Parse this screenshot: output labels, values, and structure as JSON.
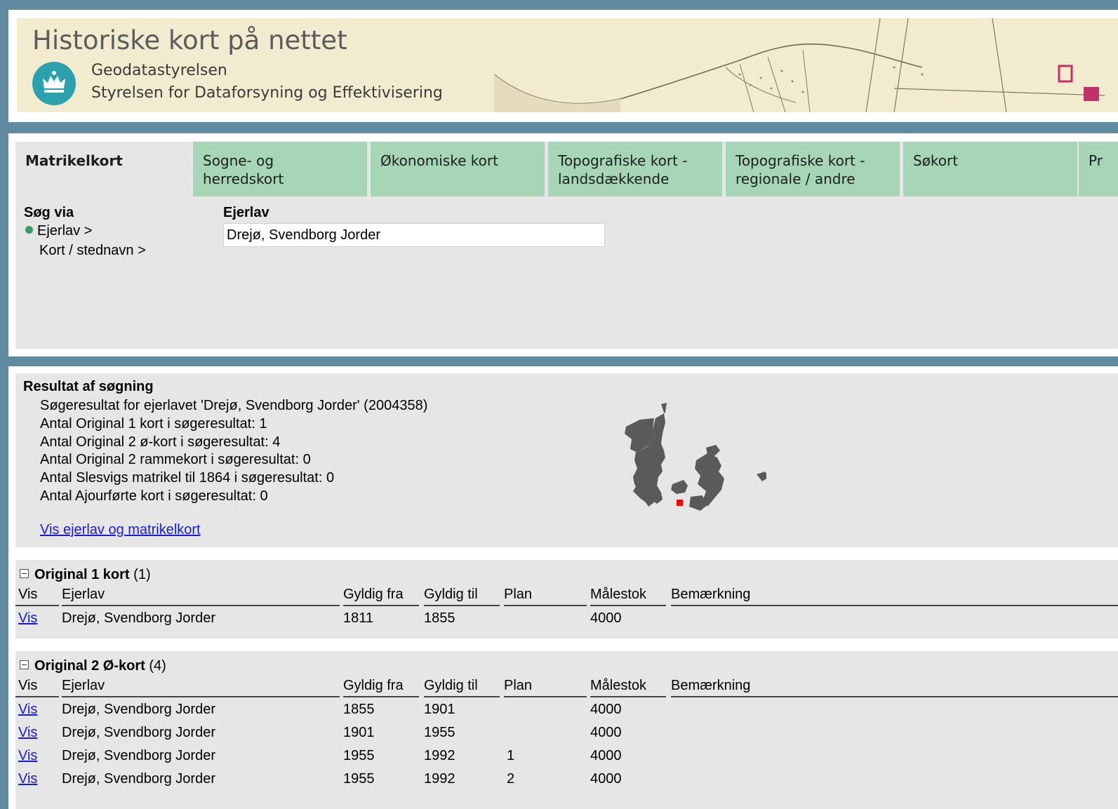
{
  "header": {
    "title": "Historiske kort på nettet",
    "org_line1": "Geodatastyrelsen",
    "org_line2": "Styrelsen for Dataforsyning og Effektivisering"
  },
  "tabs": [
    {
      "label": "Matrikelkort",
      "active": true
    },
    {
      "label": "Sogne- og herredskort"
    },
    {
      "label": "Økonomiske kort"
    },
    {
      "label": "Topografiske kort - landsdækkende"
    },
    {
      "label": "Topografiske kort - regionale / andre"
    },
    {
      "label": "Søkort"
    },
    {
      "label": "Pr"
    }
  ],
  "search": {
    "via_label": "Søg via",
    "option_ejerlav": "Ejerlav >",
    "option_kort": "Kort / stednavn >",
    "field_label": "Ejerlav",
    "field_value": "Drejø, Svendborg Jorder"
  },
  "result": {
    "title": "Resultat af søgning",
    "lines": [
      "Søgeresultat for ejerlavet 'Drejø, Svendborg Jorder' (2004358)",
      "Antal Original 1 kort i søgeresultat: 1",
      "Antal Original 2 ø-kort i søgeresultat: 4",
      "Antal Original 2 rammekort i søgeresultat: 0",
      "Antal Slesvigs matrikel til 1864 i søgeresultat: 0",
      "Antal Ajourførte kort i søgeresultat: 0"
    ],
    "link": "Vis ejerlav og matrikelkort"
  },
  "columns": [
    "Vis",
    "Ejerlav",
    "Gyldig fra",
    "Gyldig til",
    "Plan",
    "Målestok",
    "Bemærkning"
  ],
  "tables": [
    {
      "title": "Original 1 kort",
      "count": "(1)",
      "rows": [
        {
          "vis": "Vis",
          "ejerlav": "Drejø, Svendborg Jorder",
          "fra": "1811",
          "til": "1855",
          "plan": "",
          "malestok": "4000",
          "bem": ""
        }
      ]
    },
    {
      "title": "Original 2 Ø-kort",
      "count": "(4)",
      "rows": [
        {
          "vis": "Vis",
          "ejerlav": "Drejø, Svendborg Jorder",
          "fra": "1855",
          "til": "1901",
          "plan": "",
          "malestok": "4000",
          "bem": ""
        },
        {
          "vis": "Vis",
          "ejerlav": "Drejø, Svendborg Jorder",
          "fra": "1901",
          "til": "1955",
          "plan": "",
          "malestok": "4000",
          "bem": ""
        },
        {
          "vis": "Vis",
          "ejerlav": "Drejø, Svendborg Jorder",
          "fra": "1955",
          "til": "1992",
          "plan": "1",
          "malestok": "4000",
          "bem": ""
        },
        {
          "vis": "Vis",
          "ejerlav": "Drejø, Svendborg Jorder",
          "fra": "1955",
          "til": "1992",
          "plan": "2",
          "malestok": "4000",
          "bem": ""
        }
      ]
    }
  ],
  "colors": {
    "tab": "#a6d6b6",
    "frame": "#5f8aa0",
    "link": "#1a1ad8",
    "marker": "#ff0000"
  }
}
